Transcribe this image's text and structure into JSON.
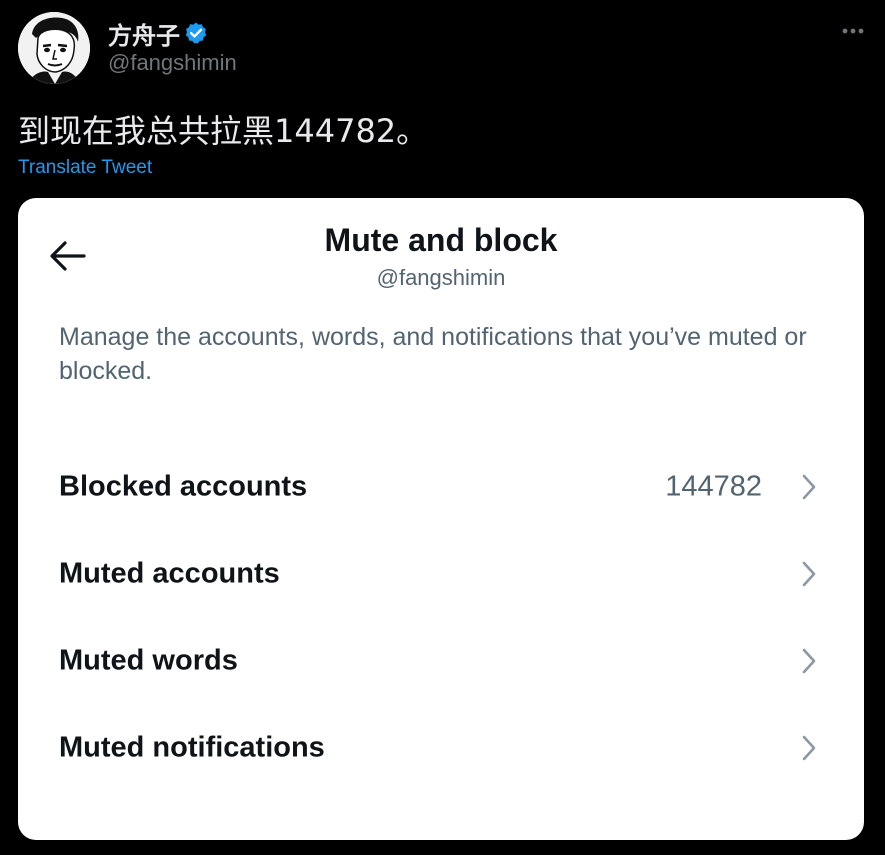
{
  "author": {
    "display_name": "方舟子",
    "handle": "@fangshimin",
    "verified": true,
    "avatar_icon": "portrait-avatar-icon"
  },
  "tweet": {
    "text": "到现在我总共拉黑144782。",
    "translate_label": "Translate Tweet"
  },
  "embedded_screenshot": {
    "title": "Mute and block",
    "subtitle": "@fangshimin",
    "description": "Manage the accounts, words, and notifications that you’ve muted or blocked.",
    "back_icon": "arrow-left-icon",
    "rows": [
      {
        "label": "Blocked accounts",
        "value": "144782",
        "icon": "chevron-right-icon"
      },
      {
        "label": "Muted accounts",
        "value": "",
        "icon": "chevron-right-icon"
      },
      {
        "label": "Muted words",
        "value": "",
        "icon": "chevron-right-icon"
      },
      {
        "label": "Muted notifications",
        "value": "",
        "icon": "chevron-right-icon"
      }
    ]
  },
  "colors": {
    "background": "#000000",
    "link": "#1d9bf0",
    "verified_badge": "#1d9bf0",
    "secondary_text": "#71767b",
    "card_background": "#ffffff",
    "card_secondary_text": "#536471"
  }
}
